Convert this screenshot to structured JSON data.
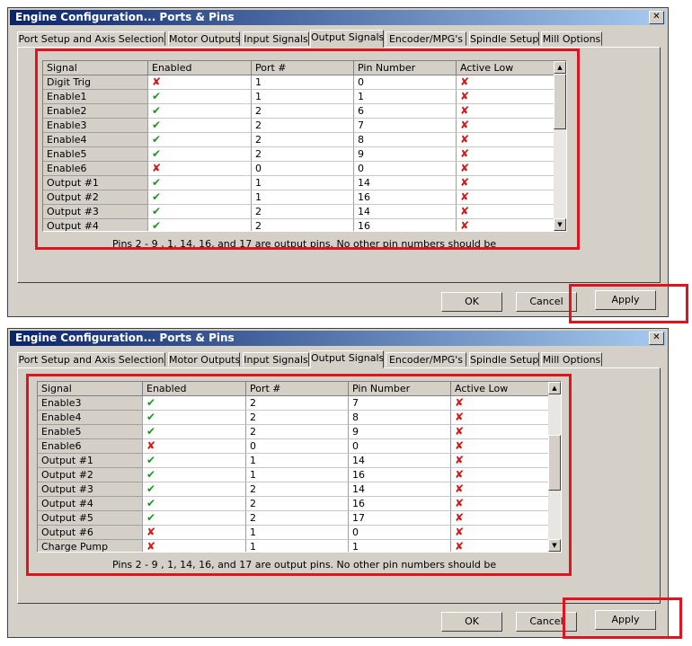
{
  "window_title": "Engine Configuration... Ports & Pins",
  "close_label": "✕",
  "tabs": [
    "Port Setup and Axis Selection",
    "Motor Outputs",
    "Input Signals",
    "Output Signals",
    "Encoder/MPG's",
    "Spindle Setup",
    "Mill Options"
  ],
  "active_tab": "Output Signals",
  "columns": [
    "Signal",
    "Enabled",
    "Port #",
    "Pin Number",
    "Active Low"
  ],
  "note": "Pins 2 - 9 , 1, 14, 16, and 17 are output pins. No  other pin numbers should be",
  "buttons": {
    "ok": "OK",
    "cancel": "Cancel",
    "apply": "Apply"
  },
  "colors": {
    "highlight": "#e0141e",
    "enabled_check": "#1a9a1a",
    "disabled_cross": "#d01818"
  },
  "icons": {
    "check": "check-icon",
    "cross": "cross-icon"
  },
  "dialogs": [
    {
      "rows": [
        {
          "signal": "Digit Trig",
          "enabled": false,
          "port": "1",
          "pin": "0",
          "active_low": false
        },
        {
          "signal": "Enable1",
          "enabled": true,
          "port": "1",
          "pin": "1",
          "active_low": false
        },
        {
          "signal": "Enable2",
          "enabled": true,
          "port": "2",
          "pin": "6",
          "active_low": false
        },
        {
          "signal": "Enable3",
          "enabled": true,
          "port": "2",
          "pin": "7",
          "active_low": false
        },
        {
          "signal": "Enable4",
          "enabled": true,
          "port": "2",
          "pin": "8",
          "active_low": false
        },
        {
          "signal": "Enable5",
          "enabled": true,
          "port": "2",
          "pin": "9",
          "active_low": false
        },
        {
          "signal": "Enable6",
          "enabled": false,
          "port": "0",
          "pin": "0",
          "active_low": false
        },
        {
          "signal": "Output #1",
          "enabled": true,
          "port": "1",
          "pin": "14",
          "active_low": false
        },
        {
          "signal": "Output #2",
          "enabled": true,
          "port": "1",
          "pin": "16",
          "active_low": false
        },
        {
          "signal": "Output #3",
          "enabled": true,
          "port": "2",
          "pin": "14",
          "active_low": false
        },
        {
          "signal": "Output #4",
          "enabled": true,
          "port": "2",
          "pin": "16",
          "active_low": false
        }
      ],
      "scroll_position": 0.0
    },
    {
      "rows": [
        {
          "signal": "Enable3",
          "enabled": true,
          "port": "2",
          "pin": "7",
          "active_low": false
        },
        {
          "signal": "Enable4",
          "enabled": true,
          "port": "2",
          "pin": "8",
          "active_low": false
        },
        {
          "signal": "Enable5",
          "enabled": true,
          "port": "2",
          "pin": "9",
          "active_low": false
        },
        {
          "signal": "Enable6",
          "enabled": false,
          "port": "0",
          "pin": "0",
          "active_low": false
        },
        {
          "signal": "Output #1",
          "enabled": true,
          "port": "1",
          "pin": "14",
          "active_low": false
        },
        {
          "signal": "Output #2",
          "enabled": true,
          "port": "1",
          "pin": "16",
          "active_low": false
        },
        {
          "signal": "Output #3",
          "enabled": true,
          "port": "2",
          "pin": "14",
          "active_low": false
        },
        {
          "signal": "Output #4",
          "enabled": true,
          "port": "2",
          "pin": "16",
          "active_low": false
        },
        {
          "signal": "Output #5",
          "enabled": true,
          "port": "2",
          "pin": "17",
          "active_low": false
        },
        {
          "signal": "Output #6",
          "enabled": false,
          "port": "1",
          "pin": "0",
          "active_low": false
        },
        {
          "signal": "Charge Pump",
          "enabled": false,
          "port": "1",
          "pin": "1",
          "active_low": false
        }
      ],
      "scroll_position": 0.45
    }
  ]
}
